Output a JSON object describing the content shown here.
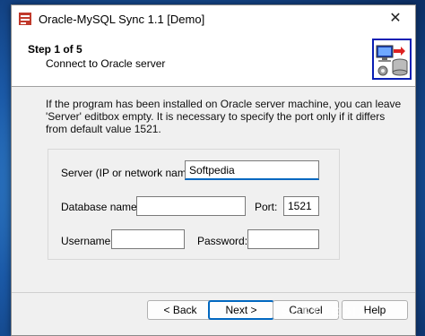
{
  "window": {
    "title": "Oracle-MySQL Sync 1.1 [Demo]",
    "close_glyph": "✕"
  },
  "header": {
    "step_title": "Step 1 of 5",
    "step_subtitle": "Connect to Oracle server"
  },
  "description": {
    "line1": "If the program has been installed on Oracle server machine, you can leave",
    "line2": "'Server' editbox empty. It is necessary to specify the port only if it differs",
    "line3": "from default value 1521."
  },
  "form": {
    "server_label": "Server (IP or network name):",
    "server_value": "Softpedia",
    "database_label": "Database name:",
    "database_value": "",
    "port_label": "Port:",
    "port_value": "1521",
    "username_label": "Username:",
    "username_value": "",
    "password_label": "Password:",
    "password_value": ""
  },
  "buttons": {
    "back": "< Back",
    "next": "Next >",
    "cancel": "Cancel",
    "help": "Help"
  },
  "watermark": "SOFTPEDIA",
  "colors": {
    "accent": "#0067c0",
    "header_icon_border": "#0a1fb4"
  },
  "icons": {
    "app": "app-db-sync-icon",
    "header": "computer-database-icon"
  }
}
